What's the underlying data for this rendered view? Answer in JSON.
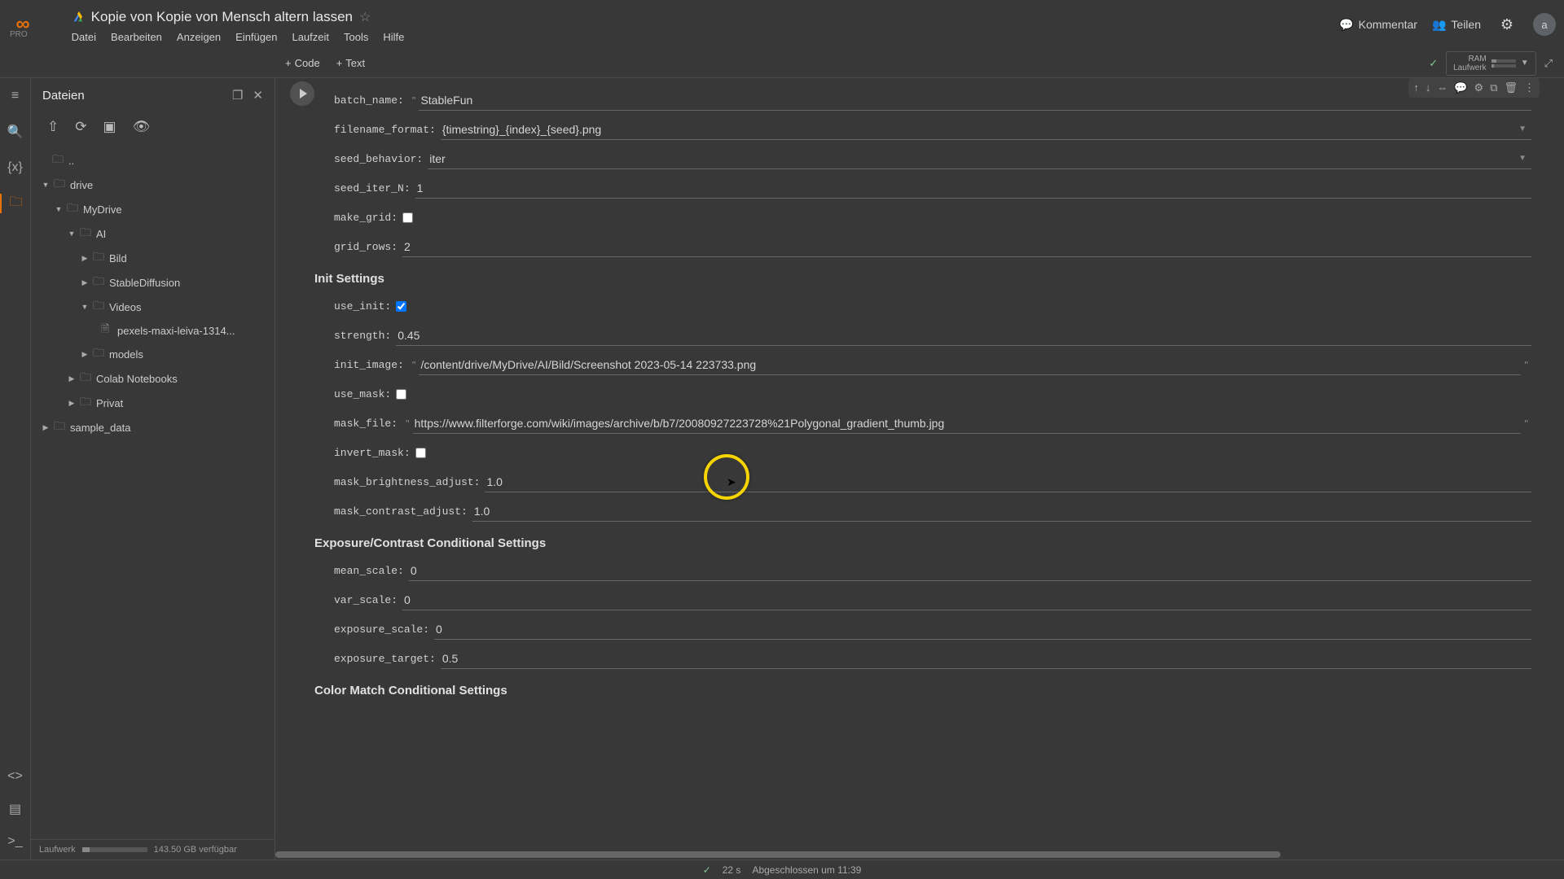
{
  "header": {
    "pro": "PRO",
    "title": "Kopie von Kopie von Mensch altern lassen",
    "menu": [
      "Datei",
      "Bearbeiten",
      "Anzeigen",
      "Einfügen",
      "Laufzeit",
      "Tools",
      "Hilfe"
    ],
    "comment": "Kommentar",
    "share": "Teilen",
    "avatar": "a"
  },
  "toolbar": {
    "code": "Code",
    "text": "Text",
    "ram_label1": "RAM",
    "ram_label2": "Laufwerk"
  },
  "sidebar": {
    "title": "Dateien",
    "tree": {
      "dotdot": "..",
      "drive": "drive",
      "mydrive": "MyDrive",
      "ai": "AI",
      "bild": "Bild",
      "sd": "StableDiffusion",
      "videos": "Videos",
      "pexels": "pexels-maxi-leiva-1314...",
      "models": "models",
      "colab": "Colab Notebooks",
      "privat": "Privat",
      "sample": "sample_data"
    },
    "foot_label": "Laufwerk",
    "foot_free": "143.50 GB verfügbar"
  },
  "form": {
    "batch_name_l": "batch_name:",
    "batch_name": "StableFun",
    "filename_format_l": "filename_format:",
    "filename_format": "{timestring}_{index}_{seed}.png",
    "seed_behavior_l": "seed_behavior:",
    "seed_behavior": "iter",
    "seed_iter_n_l": "seed_iter_N:",
    "seed_iter_n": "1",
    "make_grid_l": "make_grid:",
    "grid_rows_l": "grid_rows:",
    "grid_rows": "2",
    "init_head": "Init Settings",
    "use_init_l": "use_init:",
    "strength_l": "strength:",
    "strength": "0.45",
    "init_image_l": "init_image:",
    "init_image": "/content/drive/MyDrive/AI/Bild/Screenshot 2023-05-14 223733.png",
    "use_mask_l": "use_mask:",
    "mask_file_l": "mask_file:",
    "mask_file": "https://www.filterforge.com/wiki/images/archive/b/b7/20080927223728%21Polygonal_gradient_thumb.jpg",
    "invert_mask_l": "invert_mask:",
    "mask_brightness_l": "mask_brightness_adjust:",
    "mask_brightness": "1.0",
    "mask_contrast_l": "mask_contrast_adjust:",
    "mask_contrast": "1.0",
    "exposure_head": "Exposure/Contrast Conditional Settings",
    "mean_scale_l": "mean_scale:",
    "mean_scale": "0",
    "var_scale_l": "var_scale:",
    "var_scale": "0",
    "exposure_scale_l": "exposure_scale:",
    "exposure_scale": "0",
    "exposure_target_l": "exposure_target:",
    "exposure_target": "0.5",
    "colormatch_head": "Color Match Conditional Settings"
  },
  "status": {
    "time": "22 s",
    "msg": "Abgeschlossen um 11:39"
  }
}
